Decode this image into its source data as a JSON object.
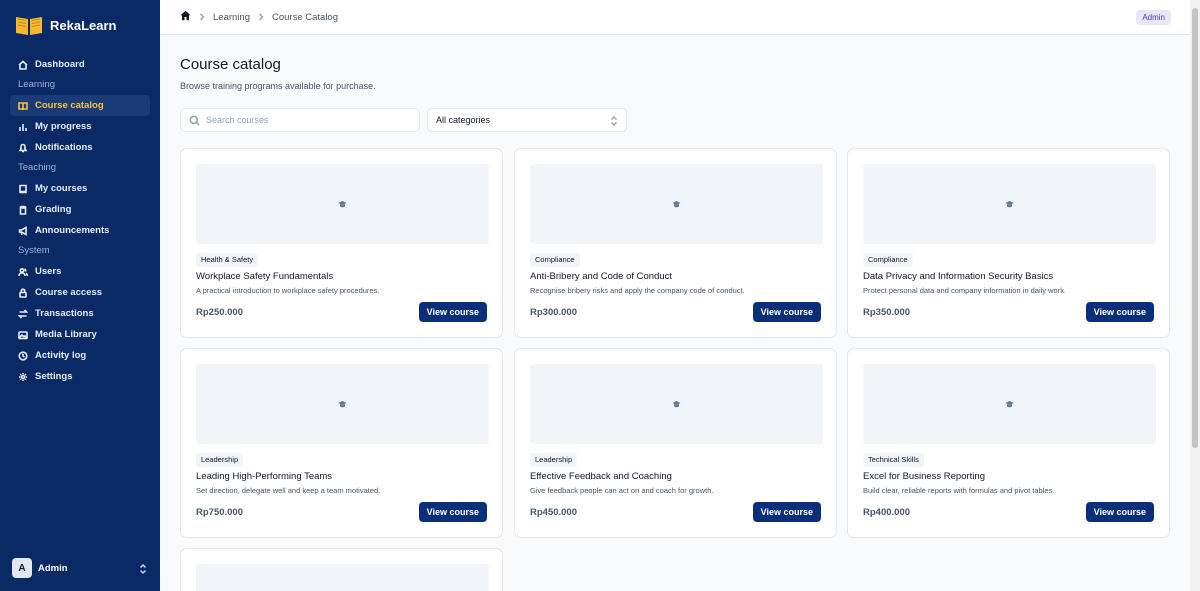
{
  "app": {
    "name": "RekaLearn"
  },
  "sidebar": {
    "dashboard": {
      "label": "Dashboard"
    },
    "sections": {
      "learning": "Learning",
      "teaching": "Teaching",
      "system": "System"
    },
    "learning_items": [
      {
        "label": "Course catalog",
        "icon": "book-open-icon",
        "active": true
      },
      {
        "label": "My progress",
        "icon": "bar-chart-icon"
      },
      {
        "label": "Notifications",
        "icon": "bell-icon"
      }
    ],
    "teaching_items": [
      {
        "label": "My courses",
        "icon": "book-icon"
      },
      {
        "label": "Grading",
        "icon": "clipboard-icon"
      },
      {
        "label": "Announcements",
        "icon": "megaphone-icon"
      }
    ],
    "system_items": [
      {
        "label": "Users",
        "icon": "users-icon"
      },
      {
        "label": "Course access",
        "icon": "lock-icon"
      },
      {
        "label": "Transactions",
        "icon": "arrows-icon"
      },
      {
        "label": "Media Library",
        "icon": "image-icon"
      },
      {
        "label": "Activity log",
        "icon": "clock-icon"
      },
      {
        "label": "Settings",
        "icon": "gear-icon"
      }
    ],
    "user": {
      "initial": "A",
      "name": "Admin"
    }
  },
  "topbar": {
    "breadcrumb": [
      "Learning",
      "Course Catalog"
    ],
    "role_badge": "Admin"
  },
  "page": {
    "title": "Course catalog",
    "subtitle": "Browse training programs available for purchase.",
    "search_placeholder": "Search courses",
    "category_filter": "All categories"
  },
  "courses": [
    {
      "tag": "Health & Safety",
      "title": "Workplace Safety Fundamentals",
      "description": "A practical introduction to workplace safety procedures.",
      "price": "Rp250.000",
      "button": "View course"
    },
    {
      "tag": "Compliance",
      "title": "Anti-Bribery and Code of Conduct",
      "description": "Recognise bribery risks and apply the company code of conduct.",
      "price": "Rp300.000",
      "button": "View course"
    },
    {
      "tag": "Compliance",
      "title": "Data Privacy and Information Security Basics",
      "description": "Protect personal data and company information in daily work.",
      "price": "Rp350.000",
      "button": "View course"
    },
    {
      "tag": "Leadership",
      "title": "Leading High-Performing Teams",
      "description": "Set direction, delegate well and keep a team motivated.",
      "price": "Rp750.000",
      "button": "View course"
    },
    {
      "tag": "Leadership",
      "title": "Effective Feedback and Coaching",
      "description": "Give feedback people can act on and coach for growth.",
      "price": "Rp450.000",
      "button": "View course"
    },
    {
      "tag": "Technical Skills",
      "title": "Excel for Business Reporting",
      "description": "Build clear, reliable reports with formulas and pivot tables.",
      "price": "Rp400.000",
      "button": "View course"
    }
  ],
  "colors": {
    "sidebar_bg": "#0a2a66",
    "active_text": "#f5c542",
    "button_bg": "#0a2f7a"
  }
}
